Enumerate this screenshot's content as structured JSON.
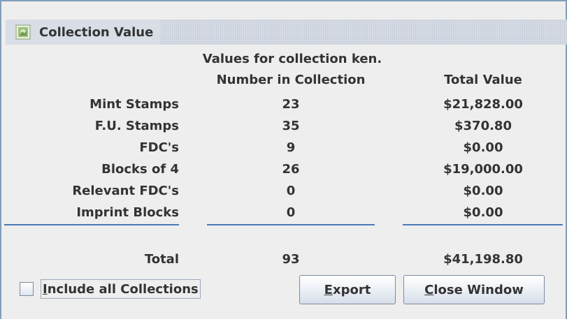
{
  "window": {
    "title": "Collection Value",
    "icon": "stamp-app-icon"
  },
  "report": {
    "heading": "Values for collection ken.",
    "count_header": "Number in Collection",
    "value_header": "Total Value",
    "rows": [
      {
        "label": "Mint Stamps",
        "count": "23",
        "value": "$21,828.00"
      },
      {
        "label": "F.U. Stamps",
        "count": "35",
        "value": "$370.80"
      },
      {
        "label": "FDC's",
        "count": "9",
        "value": "$0.00"
      },
      {
        "label": "Blocks of 4",
        "count": "26",
        "value": "$19,000.00"
      },
      {
        "label": "Relevant FDC's",
        "count": "0",
        "value": "$0.00"
      },
      {
        "label": "Imprint Blocks",
        "count": "0",
        "value": "$0.00"
      }
    ],
    "total": {
      "label": "Total",
      "count": "93",
      "value": "$41,198.80"
    }
  },
  "controls": {
    "include_all_first": "I",
    "include_all_rest": "nclude all Collections",
    "include_all_checked": false,
    "export_first": "E",
    "export_rest": "xport",
    "close_first": "C",
    "close_rest": "lose Window"
  },
  "colors": {
    "background": "#eeeeee",
    "text": "#333333",
    "separator": "#4a78b8",
    "border": "#7f9db9"
  }
}
